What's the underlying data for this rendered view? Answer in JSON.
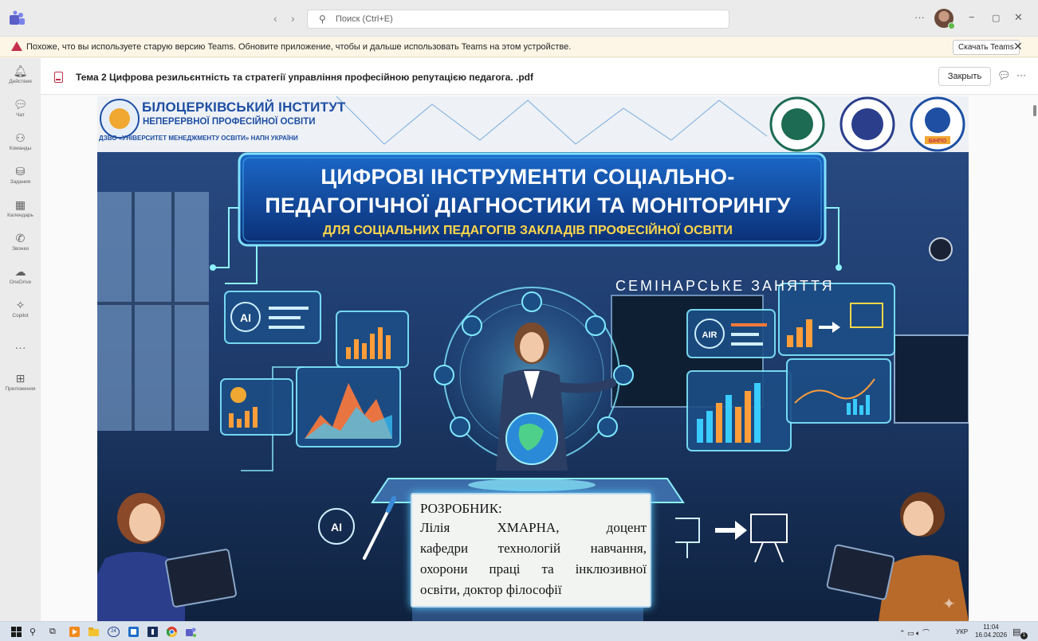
{
  "titlebar": {
    "search_placeholder": "Поиск (Ctrl+E)",
    "back": "‹",
    "forward": "›",
    "more": "···",
    "minimize": "−",
    "restore": "▢",
    "close": "✕"
  },
  "banner": {
    "text": "Похоже, что вы используете старую версию Teams. Обновите приложение, чтобы и дальше использовать Teams на этом устройстве.",
    "download_label": "Скачать Teams",
    "dismiss": "✕"
  },
  "rail": {
    "items": [
      {
        "icon": "bell-icon",
        "glyph": "🔔︎",
        "label": "Действия"
      },
      {
        "icon": "chat-icon",
        "glyph": "💬︎",
        "label": "Чат"
      },
      {
        "icon": "teams-icon",
        "glyph": "⚇",
        "label": "Команды"
      },
      {
        "icon": "assignments-icon",
        "glyph": "⛁",
        "label": "Задания"
      },
      {
        "icon": "calendar-icon",
        "glyph": "▦",
        "label": "Календарь"
      },
      {
        "icon": "phone-icon",
        "glyph": "✆",
        "label": "Звонки"
      },
      {
        "icon": "onedrive-icon",
        "glyph": "☁",
        "label": "OneDrive"
      },
      {
        "icon": "copilot-icon",
        "glyph": "✧",
        "label": "Copilot"
      },
      {
        "icon": "more-icon",
        "glyph": "···",
        "label": ""
      },
      {
        "icon": "apps-icon",
        "glyph": "⊞",
        "label": "Приложения"
      }
    ]
  },
  "document": {
    "title": "Тема 2 Цифрова резильєнтність та стратегії управління професійною репутацією педагога. .pdf",
    "close_label": "Закрыть",
    "more": "···"
  },
  "slide": {
    "institute_name": "БІЛОЦЕРКІВСЬКИЙ ІНСТИТУТ",
    "institute_sub": "НЕПЕРЕРВНОЇ ПРОФЕСІЙНОЇ ОСВІТИ",
    "institute_parent": "ДЗВО «УНІВЕРСИТЕТ МЕНЕДЖМЕНТУ ОСВІТИ» НАПН УКРАЇНИ",
    "title_line1": "ЦИФРОВІ ІНСТРУМЕНТИ СОЦІАЛЬНО-",
    "title_line2": "ПЕДАГОГІЧНОЇ ДІАГНОСТИКИ ТА МОНІТОРИНГУ",
    "subtitle": "ДЛЯ СОЦІАЛЬНИХ ПЕДАГОГІВ ЗАКЛАДІВ ПРОФЕСІЙНОЇ ОСВІТИ",
    "seminar": "СЕМІНАРСЬКЕ ЗАНЯТТЯ",
    "ai_label": "AI",
    "air_label": "AIR",
    "logo_text": "БІНПО",
    "author_title": "РОЗРОБНИК:",
    "author_lines": [
      "Лілія ХМАРНА, доцент",
      "кафедри технологій навчання,",
      "охорони праці та інклюзивної",
      "освіти, доктор філософії"
    ]
  },
  "taskbar": {
    "badge": "24",
    "language": "УКР",
    "time": "11:04",
    "date": "16.04.2026",
    "notifications": "1"
  }
}
